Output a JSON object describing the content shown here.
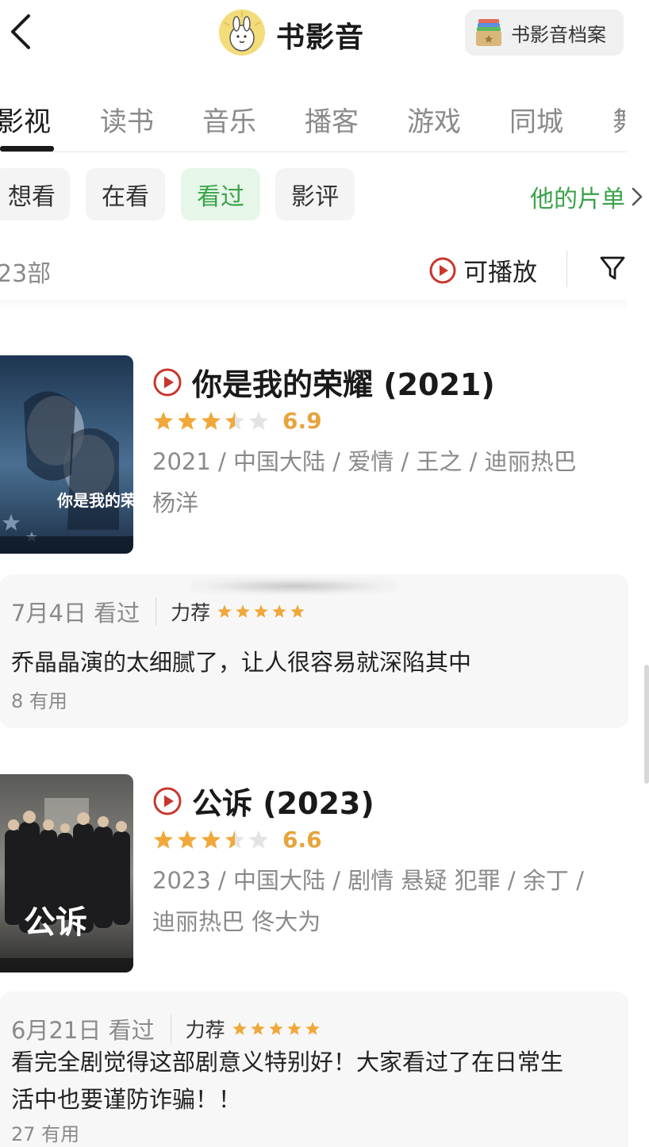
{
  "header": {
    "title": "书影音",
    "archive_label": "书影音档案"
  },
  "tabs": [
    {
      "label": "影视",
      "active": true
    },
    {
      "label": "读书",
      "active": false
    },
    {
      "label": "音乐",
      "active": false
    },
    {
      "label": "播客",
      "active": false
    },
    {
      "label": "游戏",
      "active": false
    },
    {
      "label": "同城",
      "active": false
    },
    {
      "label": "舞",
      "active": false
    }
  ],
  "filters": {
    "chips": [
      {
        "label": "想看",
        "active": false
      },
      {
        "label": "在看",
        "active": false
      },
      {
        "label": "看过",
        "active": true
      },
      {
        "label": "影评",
        "active": false
      }
    ],
    "playlist_link": "他的片单"
  },
  "list_bar": {
    "count": "23部",
    "playable_label": "可播放"
  },
  "movies": [
    {
      "title": "你是我的荣耀 (2021)",
      "rating_stars": 3.5,
      "score": "6.9",
      "meta_line1": "2021 / 中国大陆 / 爱情 / 王之 / 迪丽热巴",
      "meta_line2": "杨洋",
      "poster_text": "你是我的荣耀",
      "review": {
        "date": "7月4日 看过",
        "recommend": "力荐",
        "review_stars": 5,
        "text": "乔晶晶演的太细腻了，让人很容易就深陷其中",
        "useful": "8 有用"
      }
    },
    {
      "title": "公诉 (2023)",
      "rating_stars": 3.5,
      "score": "6.6",
      "meta_line1": "2023 / 中国大陆 / 剧情 悬疑 犯罪 / 余丁 /",
      "meta_line2": "迪丽热巴 佟大为",
      "poster_text": "公诉",
      "review": {
        "date": "6月21日 看过",
        "recommend": "力荐",
        "review_stars": 5,
        "text_line1": "看完全剧觉得这部剧意义特别好！大家看过了在日常生",
        "text_line2": "活中也要谨防诈骗！！",
        "useful": "27 有用"
      }
    }
  ],
  "colors": {
    "accent_green": "#3aa34a",
    "chip_active_bg": "#e6f6e9",
    "star_orange": "#e8a33b",
    "play_red": "#c8372d"
  }
}
